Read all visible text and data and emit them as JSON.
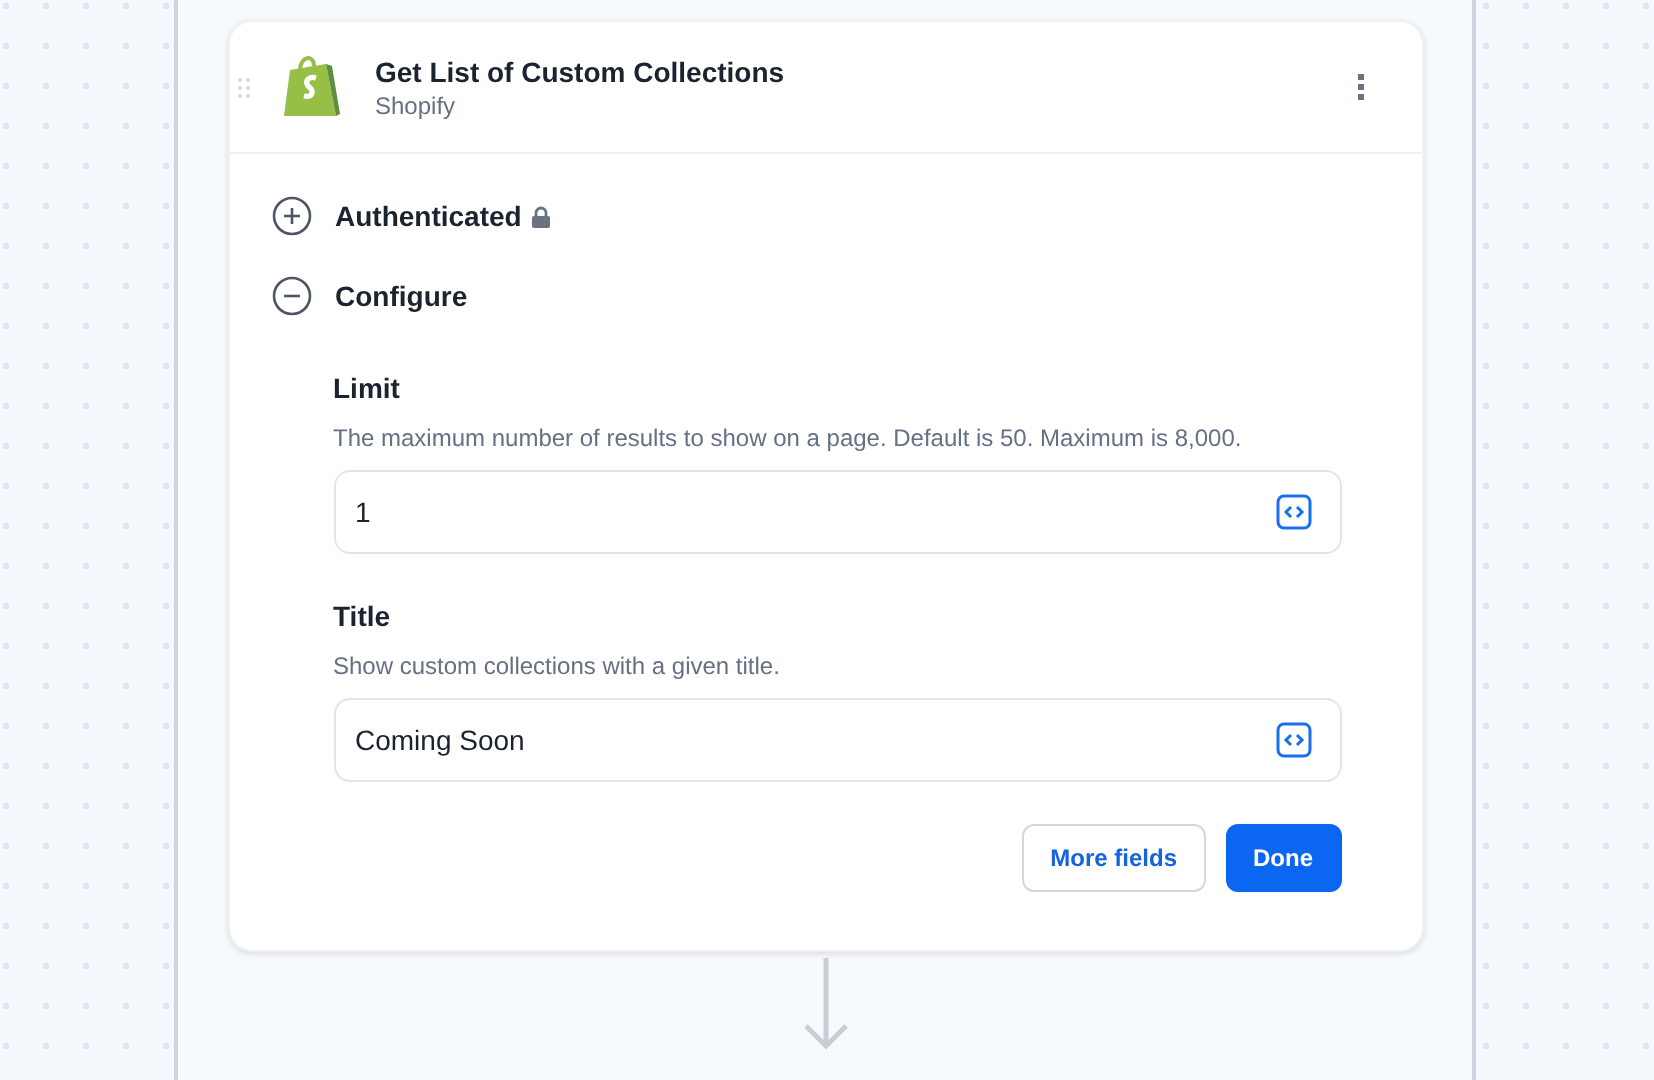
{
  "step": {
    "title": "Get List of Custom Collections",
    "app": "Shopify"
  },
  "sections": [
    {
      "label": "Authenticated",
      "expanded": false,
      "locked": true
    },
    {
      "label": "Configure",
      "expanded": true,
      "locked": false
    }
  ],
  "fields": [
    {
      "label": "Limit",
      "description": "The maximum number of results to show on a page. Default is 50. Maximum is 8,000.",
      "value": "1"
    },
    {
      "label": "Title",
      "description": "Show custom collections with a given title.",
      "value": "Coming Soon"
    }
  ],
  "buttons": [
    {
      "label": "More fields",
      "kind": "secondary"
    },
    {
      "label": "Done",
      "kind": "primary"
    }
  ]
}
